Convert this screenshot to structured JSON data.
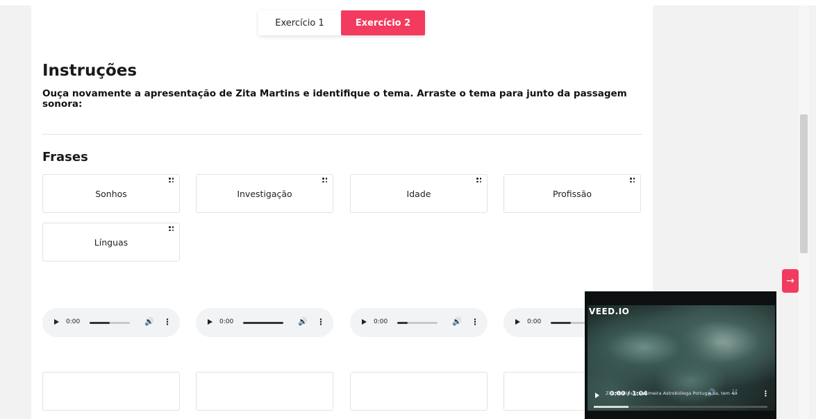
{
  "tabs": [
    {
      "label": "Exercício 1",
      "active": false
    },
    {
      "label": "Exercício 2",
      "active": true
    }
  ],
  "instructions": {
    "title": "Instruções",
    "text": "Ouça novamente a apresentação de Zita Martins e identifique o tema. Arraste o tema para junto da passagem sonora:"
  },
  "phrases": {
    "heading": "Frases",
    "items": [
      "Sonhos",
      "Investigação",
      "Idade",
      "Profissão",
      "Línguas"
    ]
  },
  "audio_players": [
    {
      "time": "0:00",
      "progress": 0.5
    },
    {
      "time": "0:00",
      "progress": 1.0
    },
    {
      "time": "0:00",
      "progress": 0.25
    },
    {
      "time": "0:00",
      "progress": 0.5
    }
  ],
  "video": {
    "brand": "VEED.IO",
    "caption": "Zita Martins é a primeira Astrobióloga Portuguesa, tem 40",
    "time": "0:00 / 1:04",
    "progress": 0.2
  },
  "next_button": {
    "icon": "arrow-right-icon",
    "glyph": "→"
  },
  "colors": {
    "accent": "#f23b5f"
  }
}
